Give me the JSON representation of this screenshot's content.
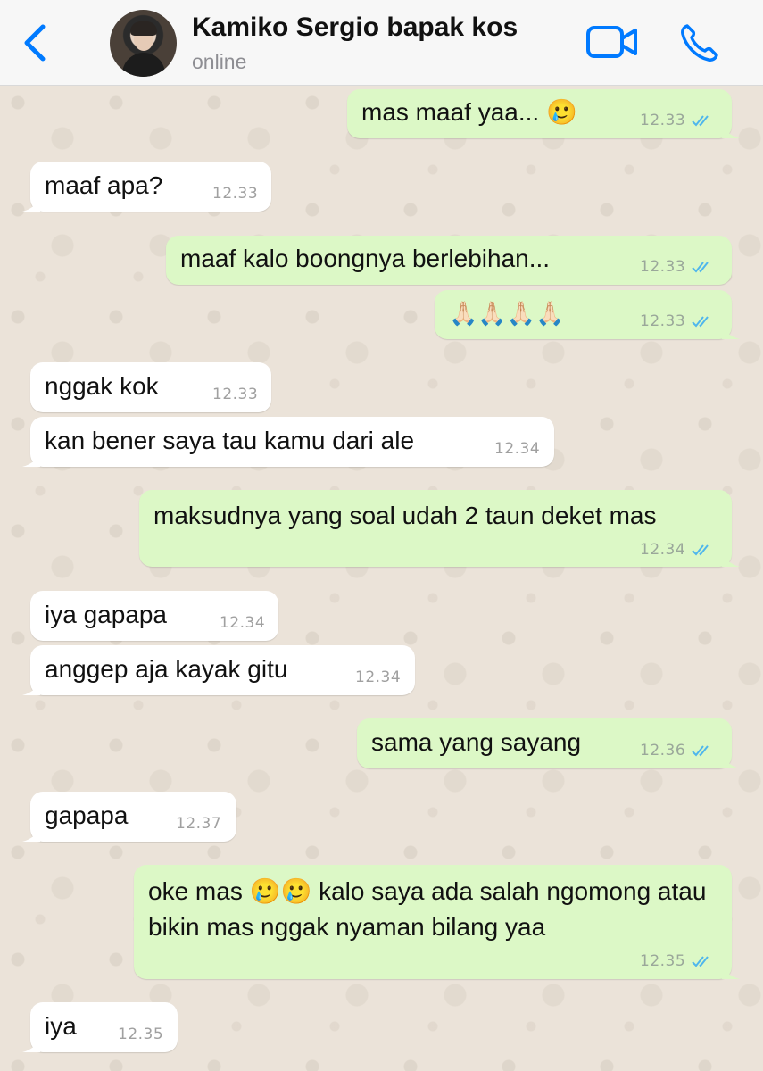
{
  "header": {
    "contact_name": "Kamiko Sergio bapak kos",
    "status": "online",
    "back_icon": "chevron-left-icon",
    "video_icon": "video-camera-icon",
    "call_icon": "phone-icon",
    "accent_color": "#007aff"
  },
  "colors": {
    "incoming_bubble": "#ffffff",
    "outgoing_bubble": "#dcf8c6",
    "read_ticks": "#4fb6ec"
  },
  "messages": [
    {
      "dir": "out",
      "text": "mas maaf yaa... 🥲",
      "time": "12.33",
      "status": "read"
    },
    {
      "dir": "in",
      "text": "maaf apa?",
      "time": "12.33"
    },
    {
      "dir": "out",
      "text": "maaf kalo boongnya berlebihan...",
      "time": "12.33",
      "status": "read"
    },
    {
      "dir": "out",
      "text": "🙏🏻🙏🏻🙏🏻🙏🏻",
      "time": "12.33",
      "status": "read"
    },
    {
      "dir": "in",
      "text": "nggak kok",
      "time": "12.33"
    },
    {
      "dir": "in",
      "text": "kan bener saya tau kamu dari ale",
      "time": "12.34"
    },
    {
      "dir": "out",
      "text": "maksudnya yang soal udah 2 taun deket mas",
      "time": "12.34",
      "status": "read"
    },
    {
      "dir": "in",
      "text": "iya gapapa",
      "time": "12.34"
    },
    {
      "dir": "in",
      "text": "anggep aja kayak gitu",
      "time": "12.34"
    },
    {
      "dir": "out",
      "text": "sama yang sayang",
      "time": "12.36",
      "status": "read"
    },
    {
      "dir": "in",
      "text": "gapapa",
      "time": "12.37"
    },
    {
      "dir": "out",
      "text": "oke mas 🥲🥲 kalo saya ada salah ngomong atau bikin mas nggak nyaman bilang yaa",
      "time": "12.35",
      "status": "read"
    },
    {
      "dir": "in",
      "text": "iya",
      "time": "12.35"
    }
  ]
}
